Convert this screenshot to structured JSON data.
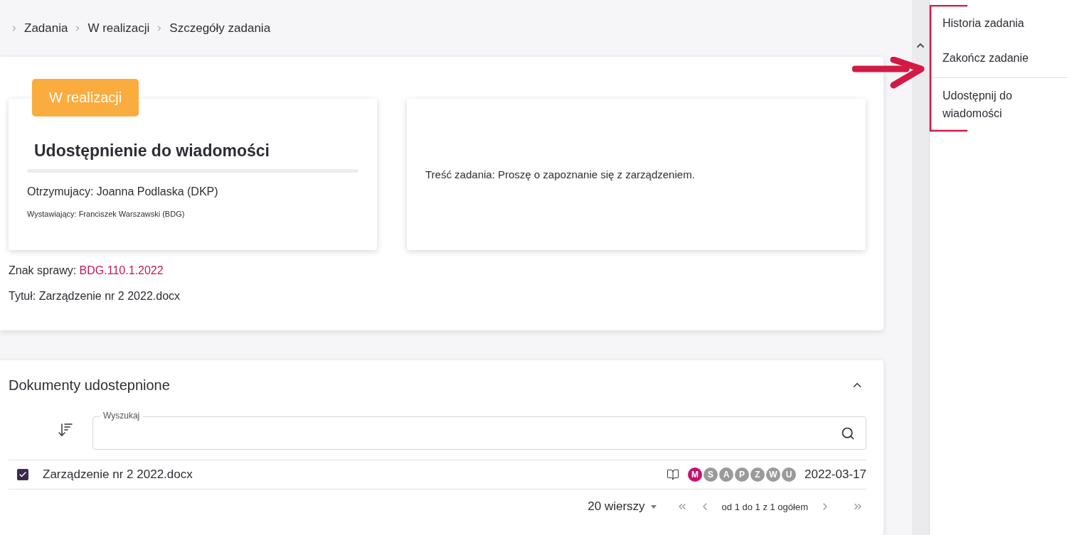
{
  "breadcrumb": [
    {
      "label": "Zadania"
    },
    {
      "label": "W realizacji"
    },
    {
      "label": "Szczegóły zadania"
    }
  ],
  "task": {
    "status": "W realizacji",
    "title": "Udostępnienie do wiadomości",
    "recipient": "Otrzymujacy: Joanna Podlaska (DKP)",
    "issuer": "Wystawiający: Franciszek Warszawski (BDG)",
    "content": "Treść zadania: Proszę o zapoznanie się z zarządzeniem.",
    "case_label": "Znak sprawy:",
    "case_number": "BDG.110.1.2022",
    "doc_title": "Tytuł: Zarządzenie nr 2 2022.docx"
  },
  "documents": {
    "title": "Dokumenty udostepnione",
    "expanded": true,
    "search": {
      "label": "Wyszukaj"
    },
    "rows": [
      {
        "name": "Zarządzenie nr 2 2022.docx",
        "checked": true,
        "letters": [
          {
            "text": "M",
            "active": true
          },
          {
            "text": "S",
            "active": false
          },
          {
            "text": "A",
            "active": false
          },
          {
            "text": "P",
            "active": false
          },
          {
            "text": "Z",
            "active": false
          },
          {
            "text": "W",
            "active": false
          },
          {
            "text": "U",
            "active": false
          }
        ],
        "date": "2022-03-17"
      }
    ],
    "pagination": {
      "rows_per_page": "20 wierszy",
      "range": "od 1 do 1 z 1 ogółem"
    }
  },
  "side_menu": [
    {
      "label": "Historia zadania"
    },
    {
      "label": "Zakończ zadanie"
    },
    {
      "label": "Udostępnij do wiadomości"
    }
  ]
}
